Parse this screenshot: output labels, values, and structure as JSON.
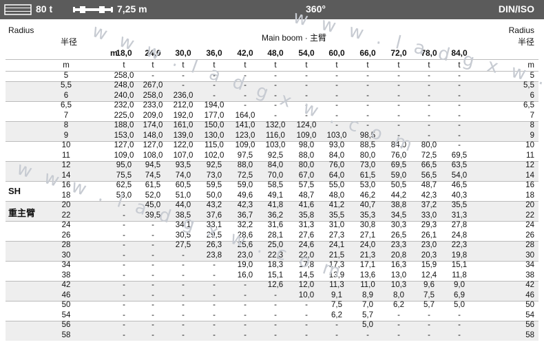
{
  "topbar": {
    "weight": "80 t",
    "boom": "7,25 m",
    "slew": "360°",
    "standard": "DIN/ISO"
  },
  "header": {
    "radius_en": "Radius",
    "radius_cn": "半径",
    "main_boom": "Main boom · 主臂",
    "m_label": "m",
    "unit_m": "m",
    "unit_t": "t"
  },
  "side_label": {
    "code": "SH",
    "cn": "重主臂"
  },
  "booms": [
    "18,0",
    "24,0",
    "30,0",
    "36,0",
    "42,0",
    "48,0",
    "54,0",
    "60,0",
    "66,0",
    "72,0",
    "78,0",
    "84,0"
  ],
  "rows": [
    {
      "r": "5",
      "v": [
        "258,0",
        "-",
        "-",
        "-",
        "-",
        "-",
        "-",
        "-",
        "-",
        "-",
        "-",
        "-"
      ]
    },
    {
      "r": "5,5",
      "v": [
        "248,0",
        "267,0",
        "-",
        "-",
        "-",
        "-",
        "-",
        "-",
        "-",
        "-",
        "-",
        "-"
      ]
    },
    {
      "r": "6",
      "v": [
        "240,0",
        "258,0",
        "236,0",
        "-",
        "-",
        "-",
        "-",
        "-",
        "-",
        "-",
        "-",
        "-"
      ]
    },
    {
      "r": "6,5",
      "v": [
        "232,0",
        "233,0",
        "212,0",
        "194,0",
        "-",
        "-",
        "-",
        "-",
        "-",
        "-",
        "-",
        "-"
      ]
    },
    {
      "r": "7",
      "v": [
        "225,0",
        "209,0",
        "192,0",
        "177,0",
        "164,0",
        "-",
        "-",
        "-",
        "-",
        "-",
        "-",
        "-"
      ]
    },
    {
      "r": "8",
      "v": [
        "188,0",
        "174,0",
        "161,0",
        "150,0",
        "141,0",
        "132,0",
        "124,0",
        "-",
        "-",
        "-",
        "-",
        "-"
      ]
    },
    {
      "r": "9",
      "v": [
        "153,0",
        "148,0",
        "139,0",
        "130,0",
        "123,0",
        "116,0",
        "109,0",
        "103,0",
        "98,5",
        "-",
        "-",
        "-"
      ]
    },
    {
      "r": "10",
      "v": [
        "127,0",
        "127,0",
        "122,0",
        "115,0",
        "109,0",
        "103,0",
        "98,0",
        "93,0",
        "88,5",
        "84,0",
        "80,0",
        "-"
      ]
    },
    {
      "r": "11",
      "v": [
        "109,0",
        "108,0",
        "107,0",
        "102,0",
        "97,5",
        "92,5",
        "88,0",
        "84,0",
        "80,0",
        "76,0",
        "72,5",
        "69,5"
      ]
    },
    {
      "r": "12",
      "v": [
        "95,0",
        "94,5",
        "93,5",
        "92,5",
        "88,0",
        "84,0",
        "80,0",
        "76,0",
        "73,0",
        "69,5",
        "66,5",
        "63,5"
      ]
    },
    {
      "r": "14",
      "v": [
        "75,5",
        "74,5",
        "74,0",
        "73,0",
        "72,5",
        "70,0",
        "67,0",
        "64,0",
        "61,5",
        "59,0",
        "56,5",
        "54,0"
      ]
    },
    {
      "r": "16",
      "v": [
        "62,5",
        "61,5",
        "60,5",
        "59,5",
        "59,0",
        "58,5",
        "57,5",
        "55,0",
        "53,0",
        "50,5",
        "48,7",
        "46,5"
      ]
    },
    {
      "r": "18",
      "v": [
        "53,0",
        "52,0",
        "51,0",
        "50,0",
        "49,6",
        "49,1",
        "48,7",
        "48,0",
        "46,2",
        "44,2",
        "42,3",
        "40,3"
      ]
    },
    {
      "r": "20",
      "v": [
        "-",
        "45,0",
        "44,0",
        "43,2",
        "42,3",
        "41,8",
        "41,6",
        "41,2",
        "40,7",
        "38,8",
        "37,2",
        "35,5"
      ]
    },
    {
      "r": "22",
      "v": [
        "-",
        "39,5",
        "38,5",
        "37,6",
        "36,7",
        "36,2",
        "35,8",
        "35,5",
        "35,3",
        "34,5",
        "33,0",
        "31,3"
      ]
    },
    {
      "r": "24",
      "v": [
        "-",
        "-",
        "34,1",
        "33,1",
        "32,2",
        "31,6",
        "31,3",
        "31,0",
        "30,8",
        "30,3",
        "29,3",
        "27,8"
      ]
    },
    {
      "r": "26",
      "v": [
        "-",
        "-",
        "30,5",
        "29,5",
        "28,6",
        "28,1",
        "27,6",
        "27,3",
        "27,1",
        "26,5",
        "26,1",
        "24,8"
      ]
    },
    {
      "r": "28",
      "v": [
        "-",
        "-",
        "27,5",
        "26,3",
        "25,6",
        "25,0",
        "24,6",
        "24,1",
        "24,0",
        "23,3",
        "23,0",
        "22,3"
      ]
    },
    {
      "r": "30",
      "v": [
        "-",
        "-",
        "-",
        "23,8",
        "23,0",
        "22,3",
        "22,0",
        "21,5",
        "21,3",
        "20,8",
        "20,3",
        "19,8"
      ]
    },
    {
      "r": "34",
      "v": [
        "-",
        "-",
        "-",
        "-",
        "19,0",
        "18,3",
        "17,8",
        "17,3",
        "17,1",
        "16,3",
        "15,9",
        "15,1"
      ]
    },
    {
      "r": "38",
      "v": [
        "-",
        "-",
        "-",
        "-",
        "16,0",
        "15,1",
        "14,5",
        "13,9",
        "13,6",
        "13,0",
        "12,4",
        "11,8"
      ]
    },
    {
      "r": "42",
      "v": [
        "-",
        "-",
        "-",
        "-",
        "-",
        "12,6",
        "12,0",
        "11,3",
        "11,0",
        "10,3",
        "9,6",
        "9,0"
      ]
    },
    {
      "r": "46",
      "v": [
        "-",
        "-",
        "-",
        "-",
        "-",
        "-",
        "10,0",
        "9,1",
        "8,9",
        "8,0",
        "7,5",
        "6,9"
      ]
    },
    {
      "r": "50",
      "v": [
        "-",
        "-",
        "-",
        "-",
        "-",
        "-",
        "-",
        "7,5",
        "7,0",
        "6,2",
        "5,7",
        "5,0"
      ]
    },
    {
      "r": "54",
      "v": [
        "-",
        "-",
        "-",
        "-",
        "-",
        "-",
        "-",
        "6,2",
        "5,7",
        "-",
        "-",
        "-"
      ]
    },
    {
      "r": "56",
      "v": [
        "-",
        "-",
        "-",
        "-",
        "-",
        "-",
        "-",
        "-",
        "5,0",
        "-",
        "-",
        "-"
      ]
    },
    {
      "r": "58",
      "v": [
        "-",
        "-",
        "-",
        "-",
        "-",
        "-",
        "-",
        "-",
        "-",
        "-",
        "-",
        "-"
      ]
    }
  ]
}
